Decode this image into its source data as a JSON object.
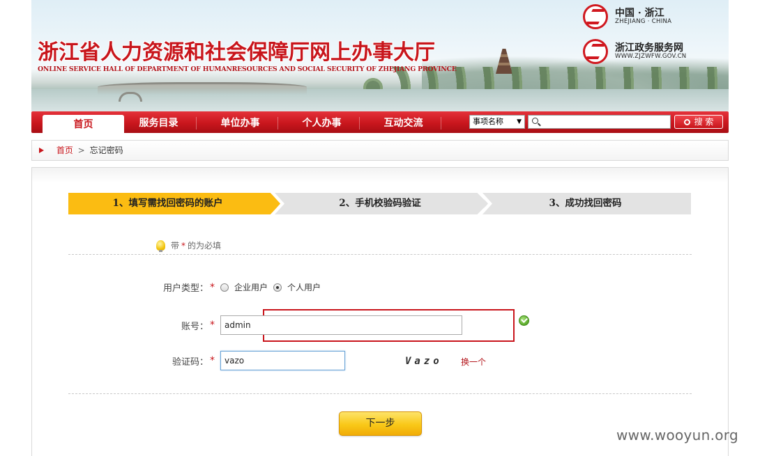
{
  "header": {
    "title": "浙江省人力资源和社会保障厅网上办事大厅",
    "subtitle": "ONLINE SERVICE HALL OF DEPARTMENT OF HUMANRESOURCES AND SOCIAL SECURITY OF ZHEJIANG PROVINCE",
    "logo_zhejiang": {
      "main": "中国 · 浙江",
      "sub": "ZHEJIANG · CHINA"
    },
    "logo_zjzwfw": {
      "main": "浙江政务服务网",
      "sub": "WWW.ZJZWFW.GOV.CN"
    }
  },
  "nav": {
    "items": [
      "首页",
      "服务目录",
      "单位办事",
      "个人办事",
      "互动交流"
    ],
    "active_index": 0,
    "search_category": "事项名称",
    "search_value": "",
    "search_button": "搜 索"
  },
  "breadcrumb": {
    "home": "首页",
    "separator": ">",
    "current": "忘记密码"
  },
  "steps": [
    "1、填写需找回密码的账户",
    "2、手机校验码验证",
    "3、成功找回密码"
  ],
  "active_step": 0,
  "required_note": {
    "prefix": "带",
    "star": "*",
    "suffix": "的为必填"
  },
  "form": {
    "user_type": {
      "label": "用户类型：",
      "options": [
        "企业用户",
        "个人用户"
      ],
      "selected": "个人用户"
    },
    "account": {
      "label": "账号：",
      "value": "admin",
      "validated": true
    },
    "captcha": {
      "label": "验证码：",
      "value": "vazo",
      "image_text": "Vazo",
      "refresh": "换一个"
    },
    "required_star": "*",
    "next_button": "下一步"
  },
  "watermark": "www.wooyun.org",
  "colors": {
    "brand_red": "#c8151b",
    "step_active": "#fbbc12",
    "step_inactive": "#e3e3e3",
    "button_yellow": "#f9c818"
  }
}
